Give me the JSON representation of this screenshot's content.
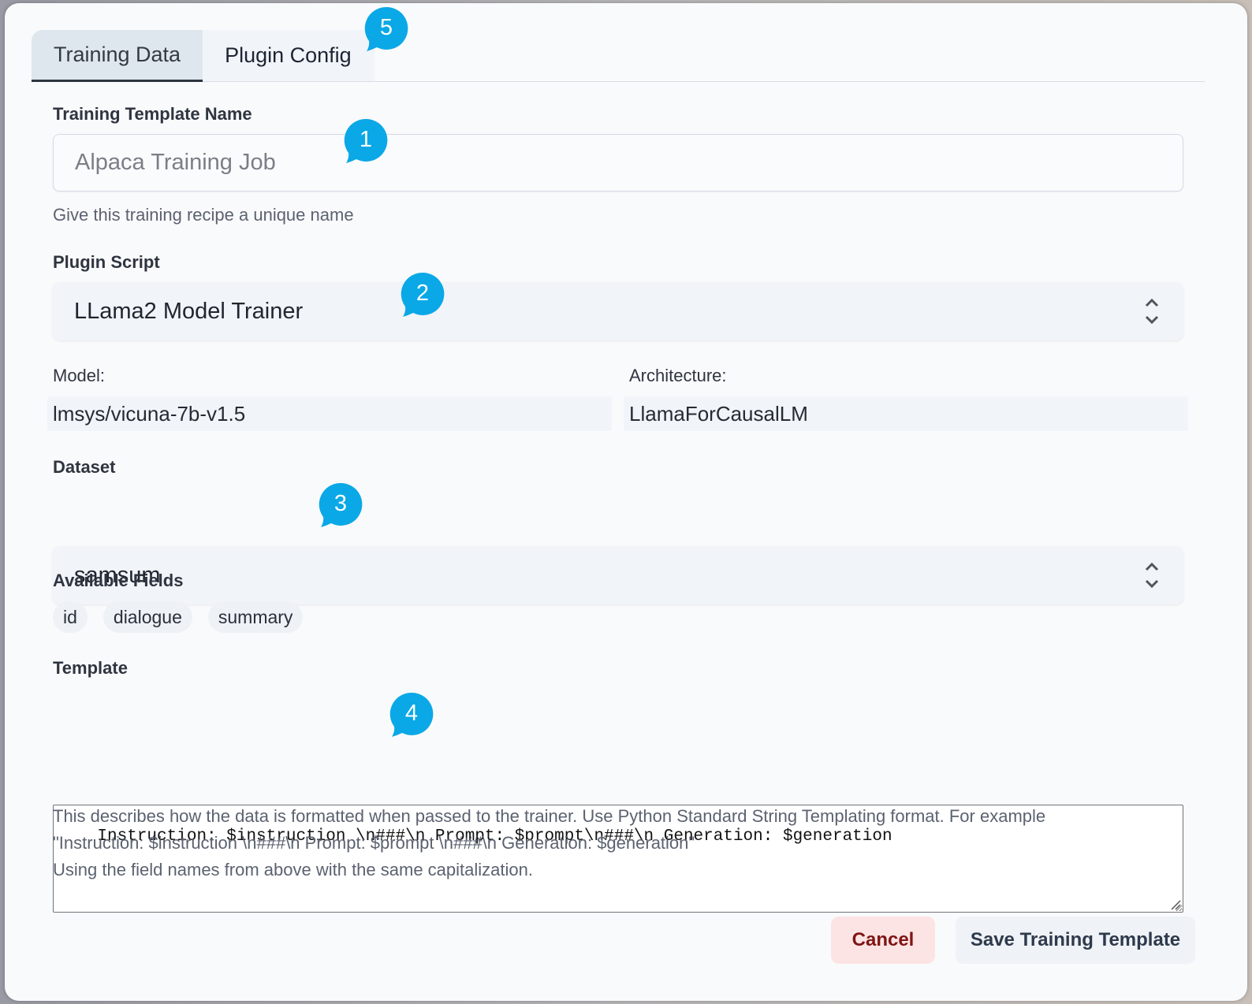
{
  "tabs": [
    {
      "label": "Training Data",
      "active": true
    },
    {
      "label": "Plugin Config",
      "active": false
    }
  ],
  "form": {
    "name": {
      "label": "Training Template Name",
      "placeholder": "Alpaca Training Job",
      "hint": "Give this training recipe a unique name"
    },
    "plugin": {
      "label": "Plugin Script",
      "value": "LLama2 Model Trainer"
    },
    "model": {
      "label": "Model:",
      "value": "lmsys/vicuna-7b-v1.5"
    },
    "architecture": {
      "label": "Architecture:",
      "value": "LlamaForCausalLM"
    },
    "dataset": {
      "label": "Dataset",
      "value": "samsum"
    },
    "fields": {
      "label": "Available Fields",
      "items": [
        "id",
        "dialogue",
        "summary"
      ]
    },
    "template": {
      "label": "Template",
      "value": "Instruction: $instruction \\n###\\n Prompt: $prompt\\n###\\n Generation: $generation",
      "description_line1": "This describes how the data is formatted when passed to the trainer. Use Python Standard String Templating format. For example",
      "description_line2": "\"Instruction: $instruction \\n###\\n Prompt: $prompt \\n###\\n Generation: $generation\"",
      "description_line3": "Using the field names from above with the same capitalization."
    }
  },
  "buttons": {
    "cancel": "Cancel",
    "save": "Save Training Template"
  },
  "markers": [
    "1",
    "2",
    "3",
    "4",
    "5"
  ],
  "colors": {
    "marker": "#0aa8e6",
    "cancel_bg": "#fde4e4",
    "cancel_text": "#7f1515",
    "save_bg": "#eff2f6"
  }
}
